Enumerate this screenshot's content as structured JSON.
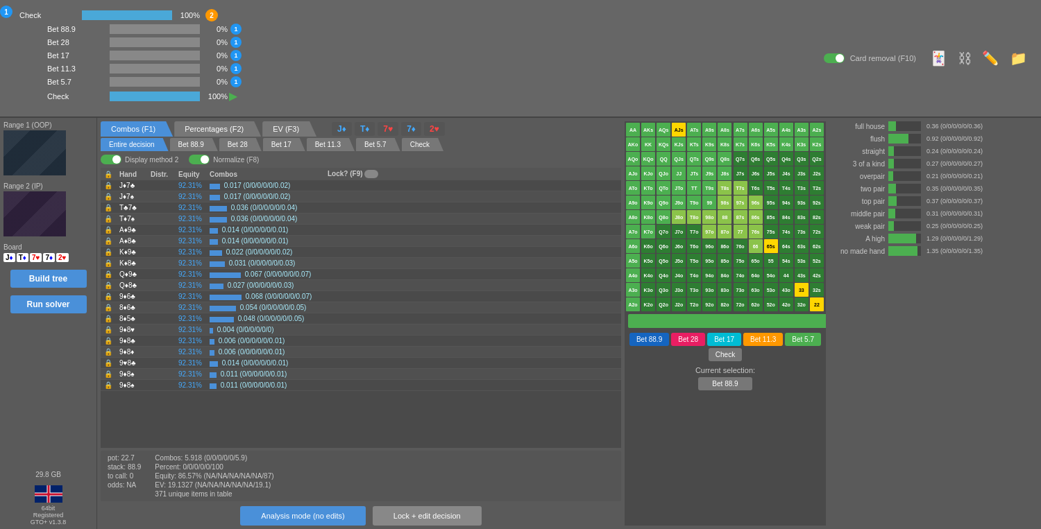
{
  "topPanel": {
    "node1Label": "1",
    "node2Label": "2",
    "actions": [
      {
        "label": "Check",
        "pct": "100%",
        "barWidth": 100,
        "badge": null,
        "isCheck": false
      },
      {
        "label": "Bet 88.9",
        "pct": "0%",
        "barWidth": 0,
        "badge": "1",
        "badgeColor": "blue"
      },
      {
        "label": "Bet 28",
        "pct": "0%",
        "barWidth": 0,
        "badge": "1",
        "badgeColor": "blue"
      },
      {
        "label": "Bet 17",
        "pct": "0%",
        "barWidth": 0,
        "badge": "1",
        "badgeColor": "blue"
      },
      {
        "label": "Bet 11.3",
        "pct": "0%",
        "barWidth": 0,
        "badge": "1",
        "badgeColor": "blue"
      },
      {
        "label": "Bet 5.7",
        "pct": "0%",
        "barWidth": 0,
        "badge": "1",
        "badgeColor": "blue"
      },
      {
        "label": "Check",
        "pct": "100%",
        "barWidth": 100,
        "badge": null,
        "isCheck": true
      }
    ],
    "cardRemoval": {
      "label": "Card removal (F10)",
      "toggled": true
    },
    "icons": [
      "card-icon",
      "network-icon",
      "edit-icon",
      "folder-icon"
    ]
  },
  "sidebar": {
    "range1Label": "Range 1 (OOP)",
    "range2Label": "Range 2 (IP)",
    "boardLabel": "Board",
    "boardCards": [
      {
        "value": "J",
        "suit": "♦",
        "color": "blue"
      },
      {
        "value": "T",
        "suit": "♦",
        "color": "blue"
      },
      {
        "value": "7",
        "suit": "♥",
        "color": "red"
      },
      {
        "value": "7",
        "suit": "♦",
        "color": "blue"
      },
      {
        "value": "2",
        "suit": "♥",
        "color": "red"
      }
    ],
    "buildTreeLabel": "Build tree",
    "runSolverLabel": "Run solver",
    "memoryLabel": "29.8 GB",
    "registeredLabel": "64bit\nRegistered\nGTO+ v1.3.8"
  },
  "tabs": [
    {
      "label": "Combos (F1)",
      "active": true
    },
    {
      "label": "Percentages (F2)",
      "active": false
    },
    {
      "label": "EV (F3)",
      "active": false
    }
  ],
  "subtabs": [
    {
      "label": "Entire decision",
      "active": true
    },
    {
      "label": "Bet 88.9",
      "active": false
    },
    {
      "label": "Bet 28",
      "active": false
    },
    {
      "label": "Bet 17",
      "active": false
    },
    {
      "label": "Bet 11.3",
      "active": false
    },
    {
      "label": "Bet 5.7",
      "active": false
    },
    {
      "label": "Check",
      "active": false
    }
  ],
  "boardDisplay": [
    {
      "value": "J♦",
      "color": "blue"
    },
    {
      "value": "T♦",
      "color": "blue"
    },
    {
      "value": "7♥",
      "color": "red"
    },
    {
      "value": "7♦",
      "color": "blue"
    },
    {
      "value": "2♥",
      "color": "red"
    }
  ],
  "tableHeader": {
    "lock": "🔒",
    "hand": "Hand",
    "distr": "Distr.",
    "equity": "Equity",
    "combos": "Combos",
    "lockF9": "Lock? (F9)"
  },
  "hands": [
    {
      "hand": "J♦7♣",
      "distr": "",
      "equity": "92.31%",
      "combos": "0.017 (0/0/0/0/0/0.02)",
      "bar": 15
    },
    {
      "hand": "J♦7♠",
      "distr": "",
      "equity": "92.31%",
      "combos": "0.017 (0/0/0/0/0/0.02)",
      "bar": 15
    },
    {
      "hand": "T♣7♣",
      "distr": "",
      "equity": "92.31%",
      "combos": "0.036 (0/0/0/0/0/0.04)",
      "bar": 25
    },
    {
      "hand": "T♦7♠",
      "distr": "",
      "equity": "92.31%",
      "combos": "0.036 (0/0/0/0/0/0.04)",
      "bar": 25
    },
    {
      "hand": "A♦9♣",
      "distr": "",
      "equity": "92.31%",
      "combos": "0.014 (0/0/0/0/0/0.01)",
      "bar": 12
    },
    {
      "hand": "A♦8♣",
      "distr": "",
      "equity": "92.31%",
      "combos": "0.014 (0/0/0/0/0/0.01)",
      "bar": 12
    },
    {
      "hand": "K♦9♣",
      "distr": "",
      "equity": "92.31%",
      "combos": "0.022 (0/0/0/0/0/0.02)",
      "bar": 18
    },
    {
      "hand": "K♦8♣",
      "distr": "",
      "equity": "92.31%",
      "combos": "0.031 (0/0/0/0/0/0.03)",
      "bar": 22
    },
    {
      "hand": "Q♦9♣",
      "distr": "",
      "equity": "92.31%",
      "combos": "0.067 (0/0/0/0/0/0.07)",
      "bar": 45
    },
    {
      "hand": "Q♦8♣",
      "distr": "",
      "equity": "92.31%",
      "combos": "0.027 (0/0/0/0/0/0.03)",
      "bar": 20
    },
    {
      "hand": "9♦6♣",
      "distr": "",
      "equity": "92.31%",
      "combos": "0.068 (0/0/0/0/0/0.07)",
      "bar": 46
    },
    {
      "hand": "8♦6♣",
      "distr": "",
      "equity": "92.31%",
      "combos": "0.054 (0/0/0/0/0/0.05)",
      "bar": 38
    },
    {
      "hand": "8♦5♣",
      "distr": "",
      "equity": "92.31%",
      "combos": "0.048 (0/0/0/0/0/0.05)",
      "bar": 35
    },
    {
      "hand": "9♦8♥",
      "distr": "",
      "equity": "92.31%",
      "combos": "0.004 (0/0/0/0/0/0)",
      "bar": 5
    },
    {
      "hand": "9♦8♣",
      "distr": "",
      "equity": "92.31%",
      "combos": "0.006 (0/0/0/0/0/0.01)",
      "bar": 7
    },
    {
      "hand": "9♦8♦",
      "distr": "",
      "equity": "92.31%",
      "combos": "0.006 (0/0/0/0/0/0.01)",
      "bar": 7
    },
    {
      "hand": "9♥8♣",
      "distr": "",
      "equity": "92.31%",
      "combos": "0.014 (0/0/0/0/0/0.01)",
      "bar": 12
    },
    {
      "hand": "9♦8♠",
      "distr": "",
      "equity": "92.31%",
      "combos": "0.011 (0/0/0/0/0/0.01)",
      "bar": 10
    },
    {
      "hand": "9♦8♠",
      "distr": "",
      "equity": "92.31%",
      "combos": "0.011 (0/0/0/0/0/0.01)",
      "bar": 10
    }
  ],
  "bottomInfo": {
    "pot": "pot: 22.7",
    "stack": "stack: 88.9",
    "toCall": "to call: 0",
    "odds": "odds: NA",
    "combos": "Combos: 5.918 (0/0/0/0/0/5.9)",
    "percent": "Percent: 0/0/0/0/0/100",
    "equity": "Equity: 86.57% (NA/NA/NA/NA/NA/87)",
    "ev": "EV: 19.1327 (NA/NA/NA/NA/NA/19.1)",
    "unique": "371 unique items in table"
  },
  "buttons": {
    "analysisMode": "Analysis mode (no edits)",
    "lockEdit": "Lock + edit decision"
  },
  "matrix": {
    "rows": [
      [
        "AA",
        "AKs",
        "AQs",
        "AJs",
        "ATs",
        "A9s",
        "A8s",
        "A7s",
        "A6s",
        "A5s",
        "A4s",
        "A3s",
        "A2s"
      ],
      [
        "AKo",
        "KK",
        "KQs",
        "KJs",
        "KTs",
        "K9s",
        "K8s",
        "K7s",
        "K6s",
        "K5s",
        "K4s",
        "K3s",
        "K2s"
      ],
      [
        "AQo",
        "KQo",
        "QQ",
        "QJs",
        "QTs",
        "Q9s",
        "Q8s",
        "Q7s",
        "Q6s",
        "Q5s",
        "Q4s",
        "Q3s",
        "Q2s"
      ],
      [
        "AJo",
        "KJo",
        "QJo",
        "JJ",
        "JTs",
        "J9s",
        "J8s",
        "J7s",
        "J6s",
        "J5s",
        "J4s",
        "J3s",
        "J2s"
      ],
      [
        "ATo",
        "KTo",
        "QTo",
        "JTo",
        "TT",
        "T9s",
        "T8s",
        "T7s",
        "T6s",
        "T5s",
        "T4s",
        "T3s",
        "T2s"
      ],
      [
        "A9o",
        "K9o",
        "Q9o",
        "J9o",
        "T9o",
        "99",
        "98s",
        "97s",
        "96s",
        "95s",
        "94s",
        "93s",
        "92s"
      ],
      [
        "A8o",
        "K8o",
        "Q8o",
        "J8o",
        "T8o",
        "98o",
        "88",
        "87s",
        "86s",
        "85s",
        "84s",
        "83s",
        "82s"
      ],
      [
        "A7o",
        "K7o",
        "Q7o",
        "J7o",
        "T7o",
        "97o",
        "87o",
        "77",
        "76s",
        "75s",
        "74s",
        "73s",
        "72s"
      ],
      [
        "A6o",
        "K6o",
        "Q6o",
        "J6o",
        "T6o",
        "96o",
        "86o",
        "76o",
        "66",
        "65s",
        "64s",
        "63s",
        "62s"
      ],
      [
        "A5o",
        "K5o",
        "Q5o",
        "J5o",
        "T5o",
        "95o",
        "85o",
        "75o",
        "65o",
        "55",
        "54s",
        "53s",
        "52s"
      ],
      [
        "A4o",
        "K4o",
        "Q4o",
        "J4o",
        "T4o",
        "94o",
        "84o",
        "74o",
        "64o",
        "54o",
        "44",
        "43s",
        "42s"
      ],
      [
        "A3o",
        "K3o",
        "Q3o",
        "J3o",
        "T3o",
        "93o",
        "83o",
        "73o",
        "63o",
        "53o",
        "43o",
        "33",
        "32s"
      ],
      [
        "A2o",
        "K2o",
        "Q2o",
        "J2o",
        "T2o",
        "92o",
        "82o",
        "72o",
        "62o",
        "52o",
        "42o",
        "32o",
        "22"
      ]
    ],
    "cellColors": {
      "AA": "mc-green",
      "AKs": "mc-green",
      "AQs": "mc-green",
      "AJs": "mc-highlight",
      "ATs": "mc-green",
      "A9s": "mc-green",
      "A8s": "mc-green",
      "A7s": "mc-green",
      "A6s": "mc-green",
      "A5s": "mc-green",
      "A4s": "mc-green",
      "A3s": "mc-green",
      "A2s": "mc-green",
      "AKo": "mc-green",
      "KK": "mc-green",
      "KQs": "mc-green",
      "KJs": "mc-green",
      "KTs": "mc-green",
      "K9s": "mc-green",
      "K8s": "mc-green",
      "K7s": "mc-green",
      "K6s": "mc-green",
      "K5s": "mc-green",
      "K4s": "mc-green",
      "K3s": "mc-green",
      "K2s": "mc-green",
      "AQo": "mc-green",
      "KQo": "mc-green",
      "QQ": "mc-green",
      "QJs": "mc-green",
      "QTs": "mc-green",
      "Q9s": "mc-green",
      "Q8s": "mc-green",
      "Q7s": "mc-darkgreen",
      "Q6s": "mc-darkgreen",
      "Q5s": "mc-darkgreen",
      "Q4s": "mc-darkgreen",
      "Q3s": "mc-darkgreen",
      "Q2s": "mc-darkgreen",
      "AJo": "mc-green",
      "KJo": "mc-green",
      "QJo": "mc-green",
      "JJ": "mc-green",
      "JTs": "mc-green",
      "J9s": "mc-green",
      "J8s": "mc-green",
      "J7s": "mc-darkgreen",
      "J6s": "mc-darkgreen",
      "J5s": "mc-darkgreen",
      "J4s": "mc-darkgreen",
      "J3s": "mc-darkgreen",
      "J2s": "mc-darkgreen",
      "ATo": "mc-green",
      "KTo": "mc-green",
      "QTo": "mc-green",
      "JTo": "mc-green",
      "TT": "mc-green",
      "T9s": "mc-green",
      "T8s": "mc-lime",
      "T7s": "mc-lime",
      "T6s": "mc-darkgreen",
      "T5s": "mc-darkgreen",
      "T4s": "mc-darkgreen",
      "T3s": "mc-darkgreen",
      "T2s": "mc-darkgreen",
      "A9o": "mc-green",
      "K9o": "mc-green",
      "Q9o": "mc-green",
      "J9o": "mc-green",
      "T9o": "mc-green",
      "99": "mc-green",
      "98s": "mc-lime",
      "97s": "mc-lime",
      "96s": "mc-lime",
      "95s": "mc-darkgreen",
      "94s": "mc-darkgreen",
      "93s": "mc-darkgreen",
      "92s": "mc-darkgreen",
      "A8o": "mc-green",
      "K8o": "mc-green",
      "Q8o": "mc-green",
      "J8o": "mc-lime",
      "T8o": "mc-lime",
      "98o": "mc-lime",
      "88": "mc-lime",
      "87s": "mc-lime",
      "86s": "mc-lime",
      "85s": "mc-darkgreen",
      "84s": "mc-darkgreen",
      "83s": "mc-darkgreen",
      "82s": "mc-darkgreen",
      "A7o": "mc-green",
      "K7o": "mc-green",
      "Q7o": "mc-darkgreen",
      "J7o": "mc-darkgreen",
      "T7o": "mc-darkgreen",
      "97o": "mc-lime",
      "87o": "mc-lime",
      "77": "mc-lime",
      "76s": "mc-lime",
      "75s": "mc-darkgreen",
      "74s": "mc-darkgreen",
      "73s": "mc-darkgreen",
      "72s": "mc-darkgreen",
      "A6o": "mc-green",
      "K6o": "mc-darkgreen",
      "Q6o": "mc-darkgreen",
      "J6o": "mc-darkgreen",
      "T6o": "mc-darkgreen",
      "96o": "mc-darkgreen",
      "86o": "mc-darkgreen",
      "76o": "mc-darkgreen",
      "66": "mc-lime",
      "65s": "mc-highlight",
      "64s": "mc-darkgreen",
      "63s": "mc-darkgreen",
      "62s": "mc-darkgreen",
      "A5o": "mc-green",
      "K5o": "mc-darkgreen",
      "Q5o": "mc-darkgreen",
      "J5o": "mc-darkgreen",
      "T5o": "mc-darkgreen",
      "95o": "mc-darkgreen",
      "85o": "mc-darkgreen",
      "75o": "mc-darkgreen",
      "65o": "mc-darkgreen",
      "55": "mc-darkgreen",
      "54s": "mc-darkgreen",
      "53s": "mc-darkgreen",
      "52s": "mc-darkgreen",
      "A4o": "mc-green",
      "K4o": "mc-darkgreen",
      "Q4o": "mc-darkgreen",
      "J4o": "mc-darkgreen",
      "T4o": "mc-darkgreen",
      "94o": "mc-darkgreen",
      "84o": "mc-darkgreen",
      "74o": "mc-darkgreen",
      "64o": "mc-darkgreen",
      "54o": "mc-darkgreen",
      "44": "mc-darkgreen",
      "43s": "mc-darkgreen",
      "42s": "mc-darkgreen",
      "A3o": "mc-green",
      "K3o": "mc-darkgreen",
      "Q3o": "mc-darkgreen",
      "J3o": "mc-darkgreen",
      "T3o": "mc-darkgreen",
      "93o": "mc-darkgreen",
      "83o": "mc-darkgreen",
      "73o": "mc-darkgreen",
      "63o": "mc-darkgreen",
      "53o": "mc-darkgreen",
      "43o": "mc-darkgreen",
      "33": "mc-highlight",
      "32s": "mc-darkgreen",
      "A2o": "mc-green",
      "K2o": "mc-darkgreen",
      "Q2o": "mc-darkgreen",
      "J2o": "mc-darkgreen",
      "T2o": "mc-darkgreen",
      "92o": "mc-darkgreen",
      "82o": "mc-darkgreen",
      "72o": "mc-darkgreen",
      "62o": "mc-darkgreen",
      "52o": "mc-darkgreen",
      "42o": "mc-darkgreen",
      "32o": "mc-darkgreen",
      "22": "mc-highlight"
    }
  },
  "legendButtons": [
    {
      "label": "Bet 88.9",
      "color": "lb-blue"
    },
    {
      "label": "Bet 28",
      "color": "lb-pink"
    },
    {
      "label": "Bet 17",
      "color": "lb-cyan"
    },
    {
      "label": "Bet 11.3",
      "color": "lb-orange"
    },
    {
      "label": "Bet 5.7",
      "color": "lb-green"
    },
    {
      "label": "Check",
      "color": "lb-gray"
    }
  ],
  "currentSelection": {
    "label": "Current selection:",
    "value": "Bet 88.9"
  },
  "handCategories": [
    {
      "label": "full house",
      "value": 0.36,
      "maxVal": 1.5,
      "display": "0.36 (0/0/0/0/0/0.36)"
    },
    {
      "label": "flush",
      "value": 0.92,
      "maxVal": 1.5,
      "display": "0.92 (0/0/0/0/0/0.92)"
    },
    {
      "label": "straight",
      "value": 0.24,
      "maxVal": 1.5,
      "display": "0.24 (0/0/0/0/0/0.24)"
    },
    {
      "label": "3 of a kind",
      "value": 0.27,
      "maxVal": 1.5,
      "display": "0.27 (0/0/0/0/0/0.27)"
    },
    {
      "label": "overpair",
      "value": 0.21,
      "maxVal": 1.5,
      "display": "0.21 (0/0/0/0/0/0.21)"
    },
    {
      "label": "two pair",
      "value": 0.35,
      "maxVal": 1.5,
      "display": "0.35 (0/0/0/0/0/0.35)"
    },
    {
      "label": "top pair",
      "value": 0.37,
      "maxVal": 1.5,
      "display": "0.37 (0/0/0/0/0/0.37)"
    },
    {
      "label": "middle pair",
      "value": 0.31,
      "maxVal": 1.5,
      "display": "0.31 (0/0/0/0/0/0.31)"
    },
    {
      "label": "weak pair",
      "value": 0.25,
      "maxVal": 1.5,
      "display": "0.25 (0/0/0/0/0/0.25)"
    },
    {
      "label": "A high",
      "value": 1.29,
      "maxVal": 1.5,
      "display": "1.29 (0/0/0/0/0/1.29)"
    },
    {
      "label": "no made hand",
      "value": 1.35,
      "maxVal": 1.5,
      "display": "1.35 (0/0/0/0/0/1.35)"
    }
  ]
}
